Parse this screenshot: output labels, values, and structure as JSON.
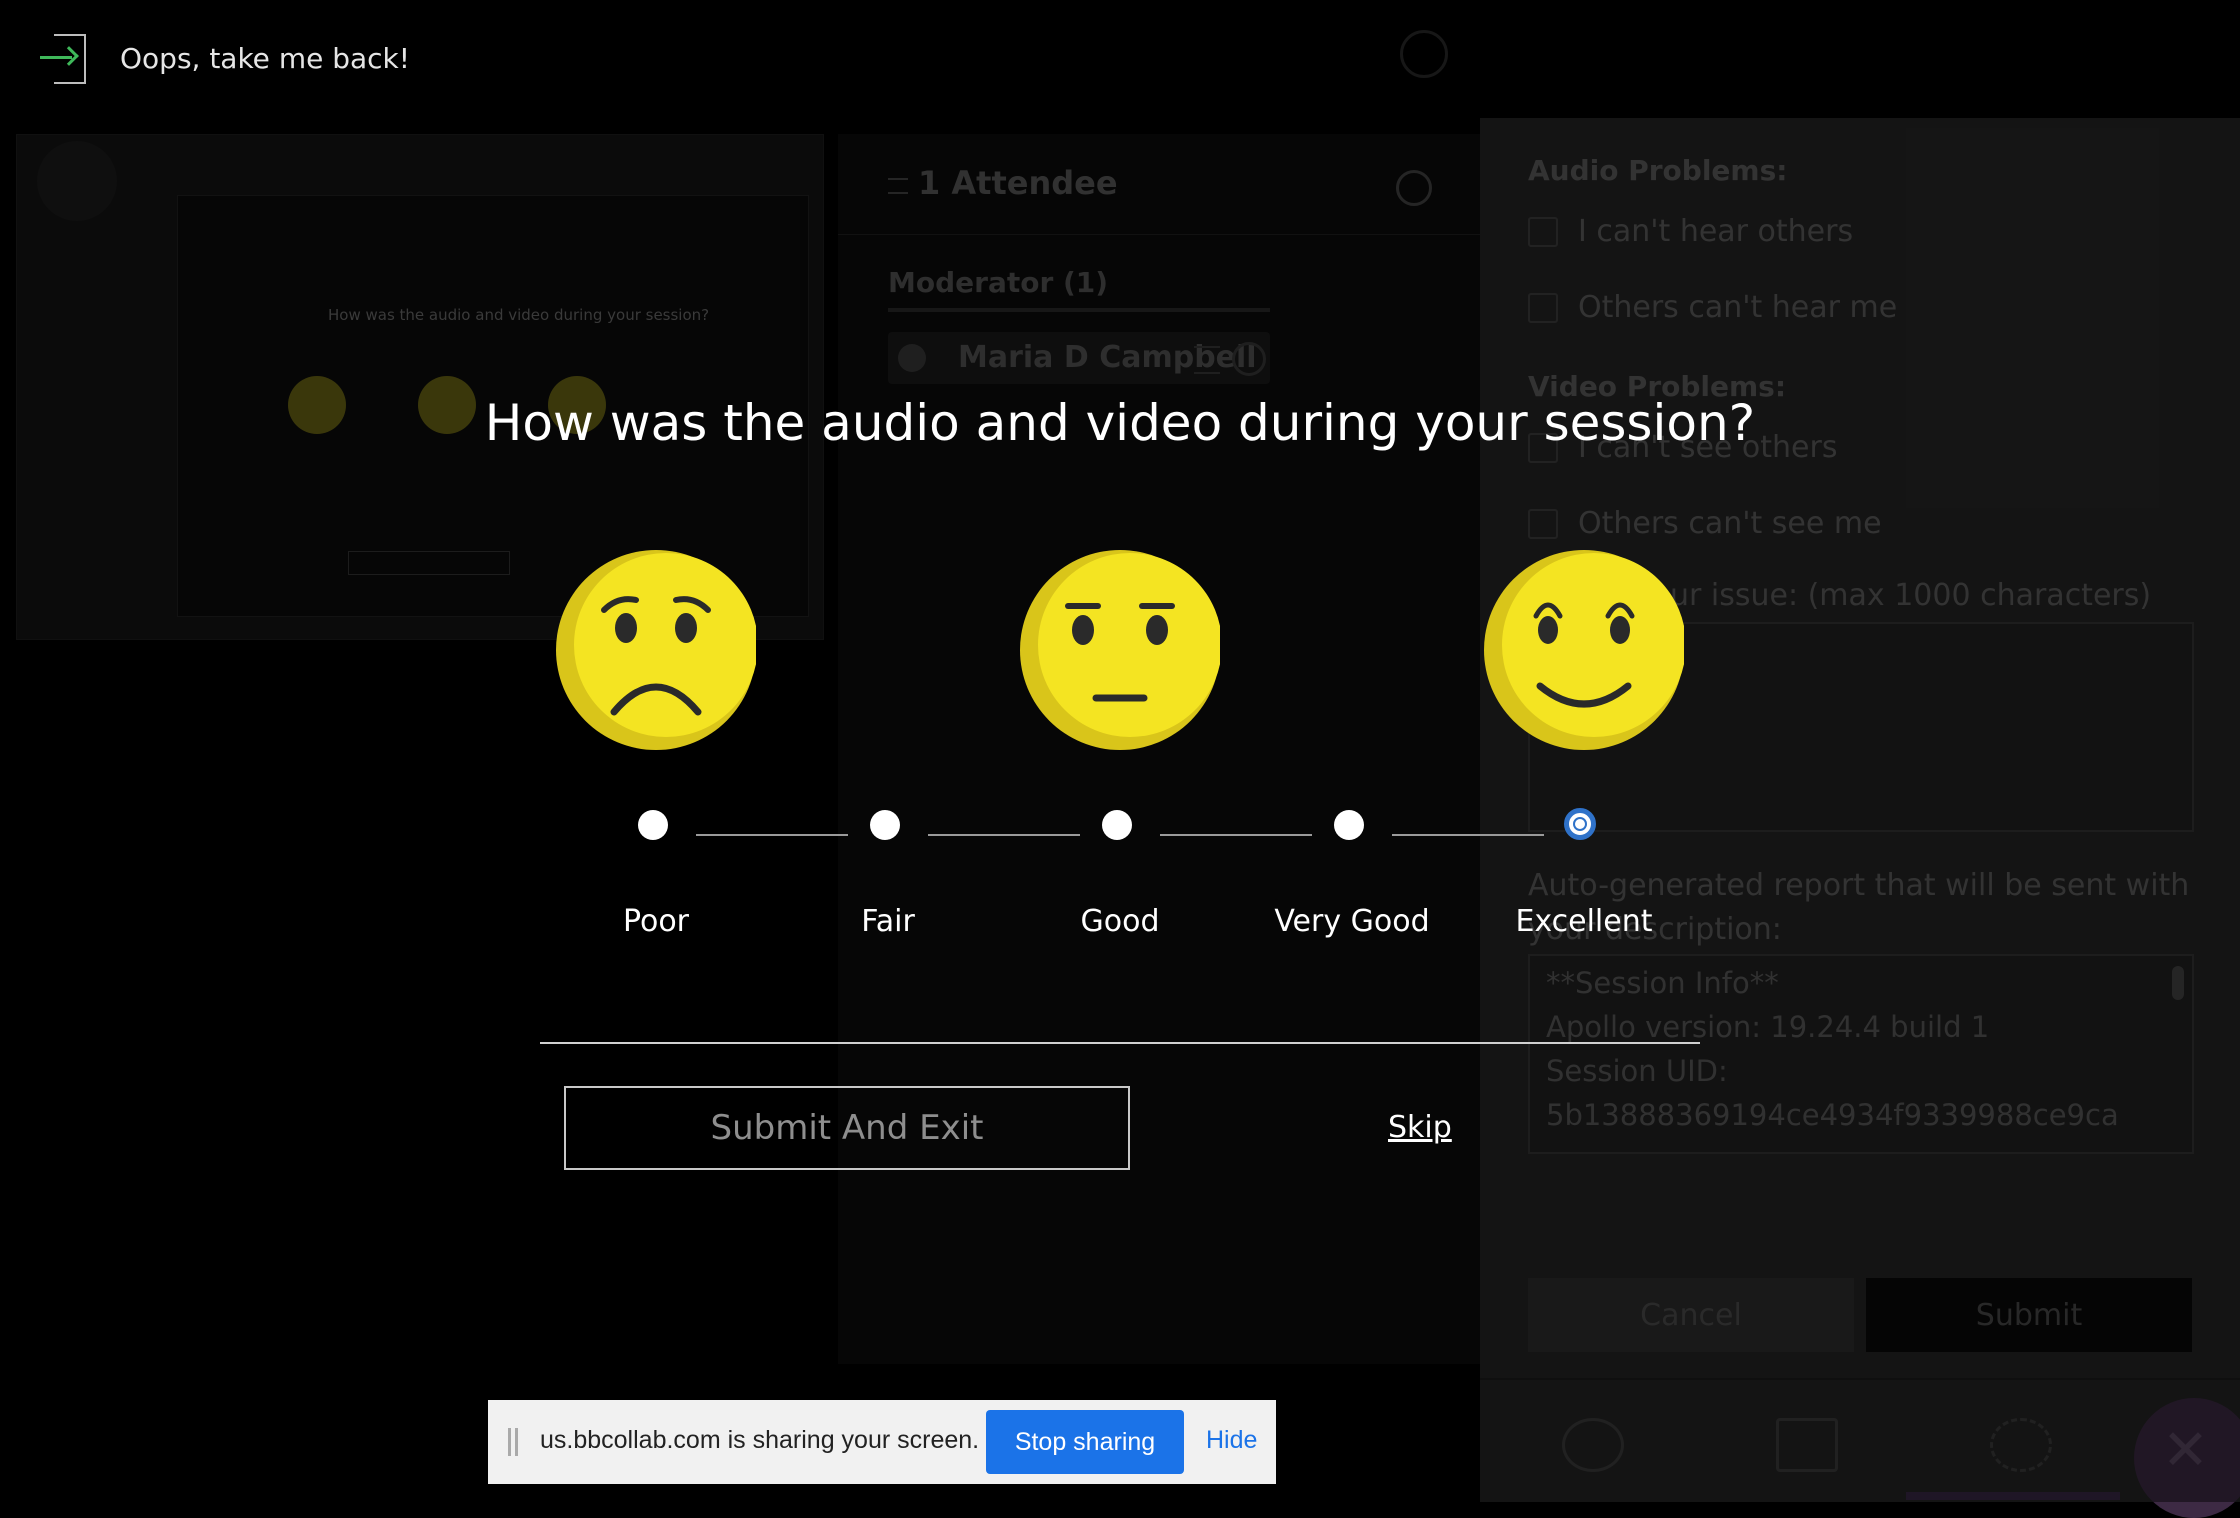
{
  "back_link": {
    "label": "Oops, take me back!"
  },
  "rating": {
    "question": "How was the audio and video during your session?",
    "options": [
      {
        "label": "Poor",
        "selected": false
      },
      {
        "label": "Fair",
        "selected": false
      },
      {
        "label": "Good",
        "selected": false
      },
      {
        "label": "Very Good",
        "selected": false
      },
      {
        "label": "Excellent",
        "selected": true
      }
    ],
    "faces": [
      "sad-face-icon",
      "neutral-face-icon",
      "happy-face-icon"
    ],
    "face_color": "#f4e422",
    "selected_color": "#2f72c9",
    "submit_label": "Submit And Exit",
    "skip_label": "Skip"
  },
  "thumbnail": {
    "question": "How was the audio and video during your session?"
  },
  "attendees": {
    "title": "1 Attendee",
    "moderator_header": "Moderator (1)",
    "moderator_name": "Maria D Campbell"
  },
  "feedback": {
    "audio_label": "Audio Problems:",
    "audio_options": [
      "I can't hear others",
      "Others can't hear me"
    ],
    "video_label": "Video Problems:",
    "video_options": [
      "I can't see others",
      "Others can't see me"
    ],
    "describe_label": "ur issue: (max 1000 characters)",
    "auto_report_label": "Auto-generated report that will be sent with your description:",
    "report_lines": [
      "**Session Info**",
      "Apollo version: 19.24.4 build 1",
      "Session UID:",
      "5b13888369194ce4934f9339988ce9ca"
    ],
    "cancel_label": "Cancel",
    "submit_label": "Submit"
  },
  "sharing_bar": {
    "message": "us.bbcollab.com is sharing your screen.",
    "stop_label": "Stop sharing",
    "hide_label": "Hide",
    "accent": "#1b73e8"
  }
}
